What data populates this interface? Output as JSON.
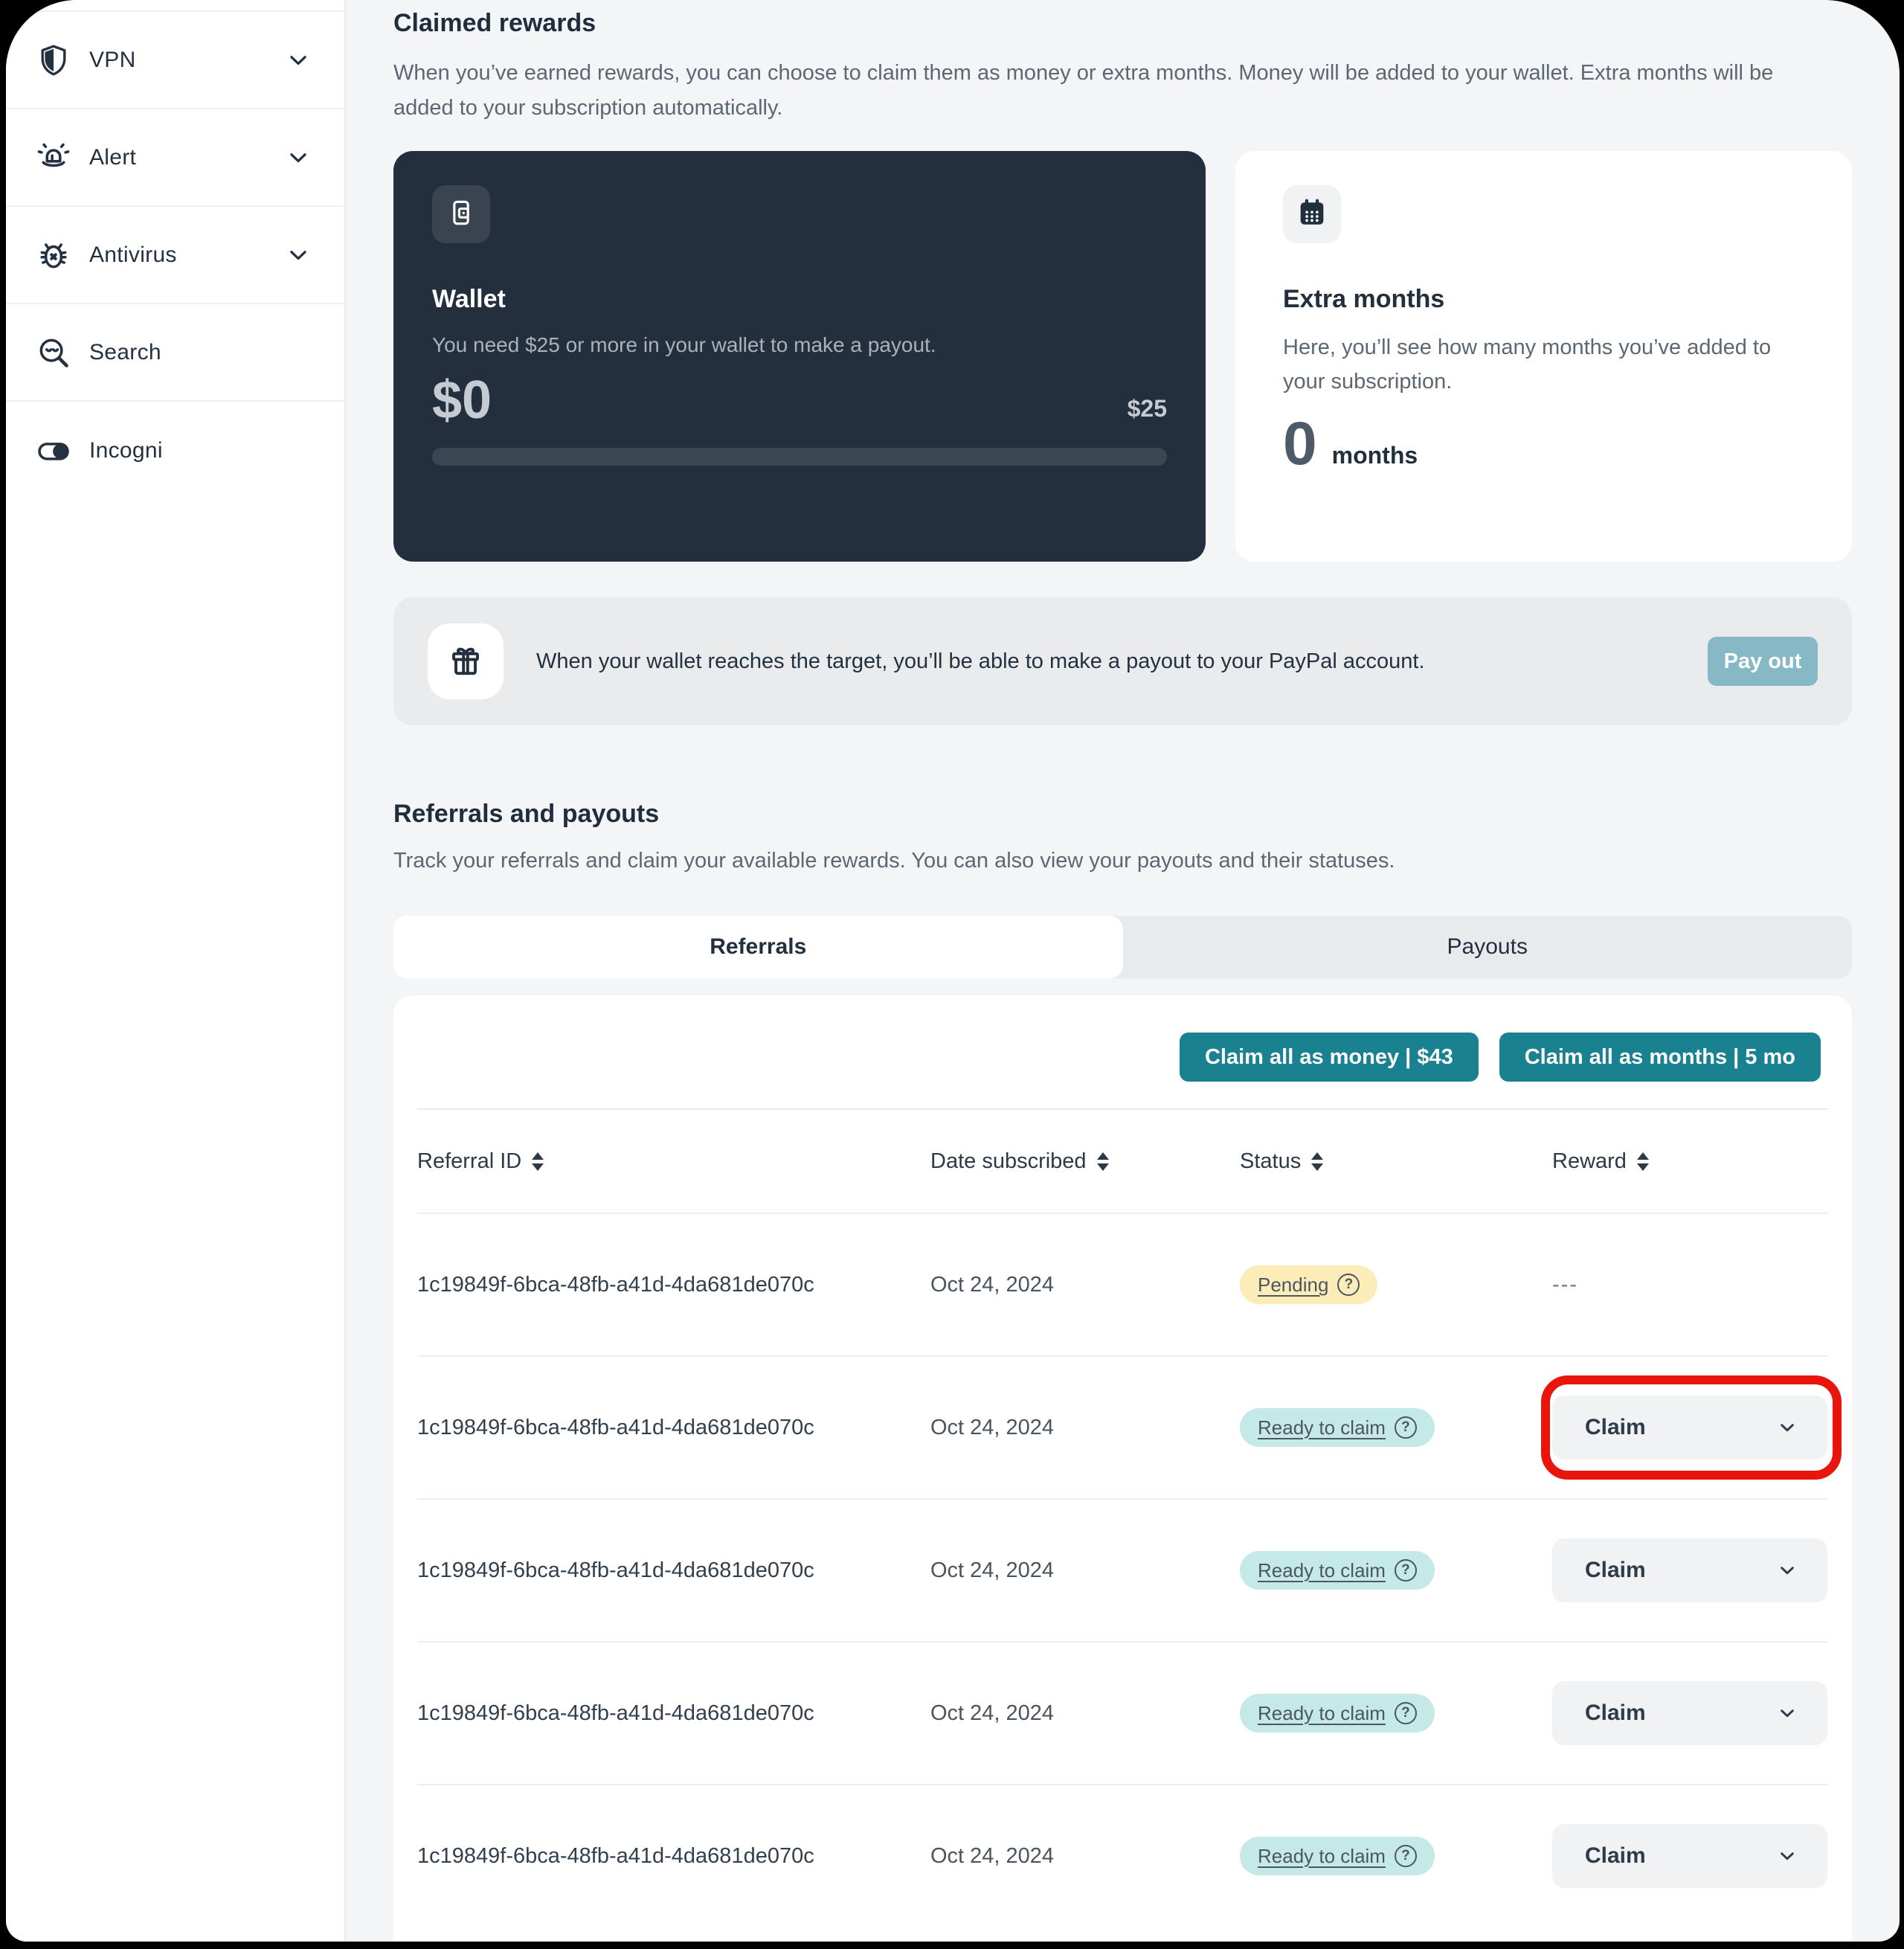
{
  "sidebar": {
    "items": [
      {
        "label": "VPN",
        "icon": "shield-icon",
        "expandable": true
      },
      {
        "label": "Alert",
        "icon": "alert-light-icon",
        "expandable": true
      },
      {
        "label": "Antivirus",
        "icon": "bug-icon",
        "expandable": true
      },
      {
        "label": "Search",
        "icon": "magnifier-icon",
        "expandable": false
      },
      {
        "label": "Incogni",
        "icon": "toggle-icon",
        "expandable": false
      }
    ]
  },
  "claimed_rewards": {
    "title": "Claimed rewards",
    "description": "When you’ve earned rewards, you can choose to claim them as money or extra months. Money will be added to your wallet. Extra months will be added to your subscription automatically.",
    "wallet": {
      "title": "Wallet",
      "description": "You need $25 or more in your wallet to make a payout.",
      "balance": "$0",
      "target": "$25",
      "progress_percent": 0
    },
    "extra_months": {
      "title": "Extra months",
      "description": "Here, you’ll see how many months you’ve added to your subscription.",
      "value": "0",
      "unit": "months"
    }
  },
  "payout_banner": {
    "message": "When your wallet reaches the target, you’ll be able to make a payout to your PayPal account.",
    "button_label": "Pay out"
  },
  "referrals_section": {
    "title": "Referrals and payouts",
    "description": "Track your referrals and claim your available rewards. You can also view your payouts and their statuses.",
    "tabs": [
      {
        "label": "Referrals",
        "active": true
      },
      {
        "label": "Payouts",
        "active": false
      }
    ],
    "claim_all_money_label": "Claim all as money | $43",
    "claim_all_months_label": "Claim all as months | 5 mo",
    "table": {
      "columns": [
        "Referral ID",
        "Date subscribed",
        "Status",
        "Reward"
      ],
      "claim_label": "Claim",
      "rows": [
        {
          "referral_id": "1c19849f-6bca-48fb-a41d-4da681de070c",
          "date_subscribed": "Oct 24, 2024",
          "status": "Pending",
          "status_type": "pending",
          "reward_type": "none",
          "reward_text": "---",
          "highlighted": false
        },
        {
          "referral_id": "1c19849f-6bca-48fb-a41d-4da681de070c",
          "date_subscribed": "Oct 24, 2024",
          "status": "Ready to claim",
          "status_type": "ready",
          "reward_type": "claim",
          "reward_text": "Claim",
          "highlighted": true
        },
        {
          "referral_id": "1c19849f-6bca-48fb-a41d-4da681de070c",
          "date_subscribed": "Oct 24, 2024",
          "status": "Ready to claim",
          "status_type": "ready",
          "reward_type": "claim",
          "reward_text": "Claim",
          "highlighted": false
        },
        {
          "referral_id": "1c19849f-6bca-48fb-a41d-4da681de070c",
          "date_subscribed": "Oct 24, 2024",
          "status": "Ready to claim",
          "status_type": "ready",
          "reward_type": "claim",
          "reward_text": "Claim",
          "highlighted": false
        },
        {
          "referral_id": "1c19849f-6bca-48fb-a41d-4da681de070c",
          "date_subscribed": "Oct 24, 2024",
          "status": "Ready to claim",
          "status_type": "ready",
          "reward_type": "claim",
          "reward_text": "Claim",
          "highlighted": false
        }
      ]
    }
  },
  "colors": {
    "accent_teal": "#1a8191",
    "payout_button": "#86b8c5",
    "dark_card": "#242f3e",
    "pending_badge": "#fcecb7",
    "ready_badge": "#c5e9e7",
    "highlight_red": "#e9140c",
    "window_background": "#f4f5f6"
  }
}
